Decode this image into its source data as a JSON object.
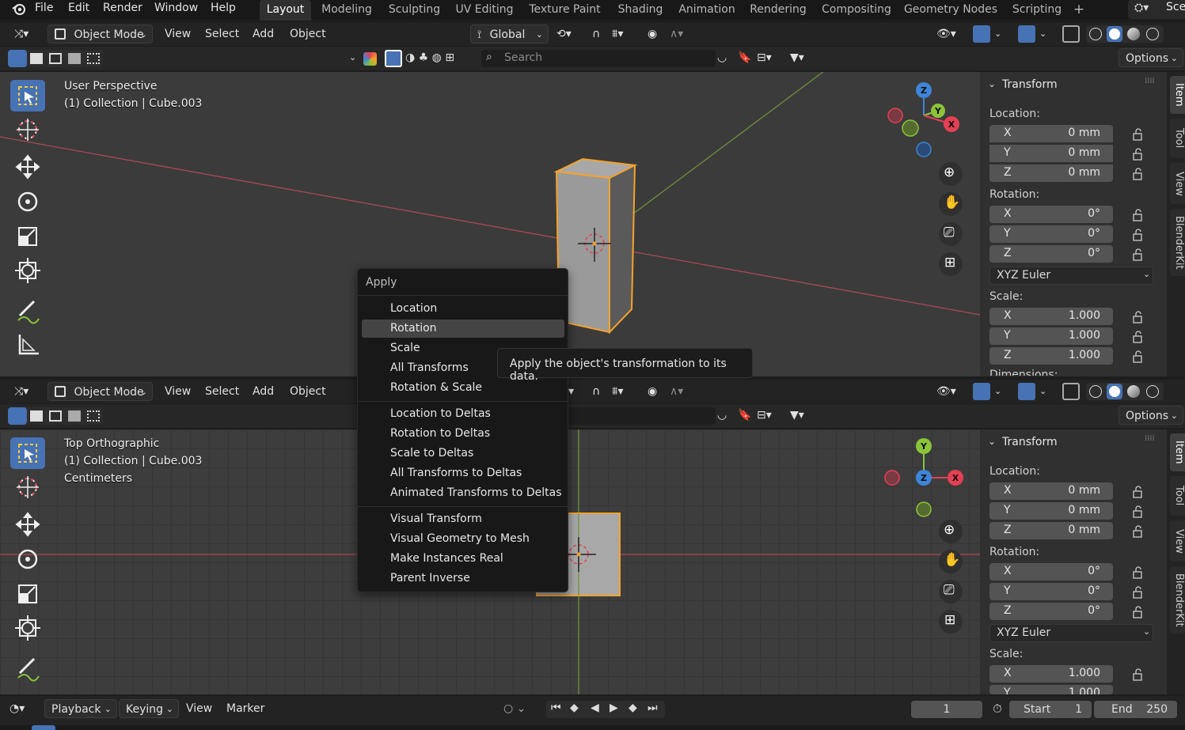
{
  "topbar": {
    "menus": [
      "File",
      "Edit",
      "Render",
      "Window",
      "Help"
    ],
    "workspace_tabs": [
      "Layout",
      "Modeling",
      "Sculpting",
      "UV Editing",
      "Texture Paint",
      "Shading",
      "Animation",
      "Rendering",
      "Compositing",
      "Geometry Nodes",
      "Scripting"
    ],
    "active_tab": "Layout",
    "add_tab": "+",
    "scene_label": "Sce"
  },
  "viewport_header": {
    "mode": "Object Mode",
    "menus": [
      "View",
      "Select",
      "Add",
      "Object"
    ],
    "orientation": "Global",
    "search_placeholder": "Search",
    "options": "Options"
  },
  "viewport_top": {
    "view_name": "User Perspective",
    "collection": "(1) Collection | Cube.003",
    "gizmo": {
      "x": "X",
      "y": "Y",
      "z": "Z"
    }
  },
  "viewport_bottom": {
    "view_name": "Top Orthographic",
    "collection": "(1) Collection | Cube.003",
    "units": "Centimeters",
    "gizmo": {
      "x": "X",
      "y": "Y",
      "z": "Z"
    }
  },
  "npanel": {
    "title": "Transform",
    "location_label": "Location:",
    "rotation_label": "Rotation:",
    "scale_label": "Scale:",
    "dimensions_label": "Dimensions:",
    "location": [
      {
        "axis": "X",
        "value": "0 mm"
      },
      {
        "axis": "Y",
        "value": "0 mm"
      },
      {
        "axis": "Z",
        "value": "0 mm"
      }
    ],
    "rotation": [
      {
        "axis": "X",
        "value": "0°"
      },
      {
        "axis": "Y",
        "value": "0°"
      },
      {
        "axis": "Z",
        "value": "0°"
      }
    ],
    "rotation_mode": "XYZ Euler",
    "scale": [
      {
        "axis": "X",
        "value": "1.000"
      },
      {
        "axis": "Y",
        "value": "1.000"
      },
      {
        "axis": "Z",
        "value": "1.000"
      }
    ],
    "side_tabs": [
      "Item",
      "Tool",
      "View",
      "BlenderKit"
    ]
  },
  "apply_menu": {
    "title": "Apply",
    "groups": [
      [
        "Location",
        "Rotation",
        "Scale",
        "All Transforms",
        "Rotation & Scale"
      ],
      [
        "Location to Deltas",
        "Rotation to Deltas",
        "Scale to Deltas",
        "All Transforms to Deltas",
        "Animated Transforms to Deltas"
      ],
      [
        "Visual Transform",
        "Visual Geometry to Mesh",
        "Make Instances Real",
        "Parent Inverse"
      ]
    ],
    "highlighted": "Rotation"
  },
  "tooltip": "Apply the object's transformation to its data.",
  "timeline": {
    "menus": [
      "Playback",
      "Keying",
      "View",
      "Marker"
    ],
    "current_frame": "1",
    "start_label": "Start",
    "start_value": "1",
    "end_label": "End",
    "end_value": "250"
  },
  "colors": {
    "accent": "#4772b3",
    "selection_orange": "#f6a22a",
    "axis_x": "#e44054",
    "axis_y": "#8bc43a",
    "axis_z": "#3d85d8"
  }
}
